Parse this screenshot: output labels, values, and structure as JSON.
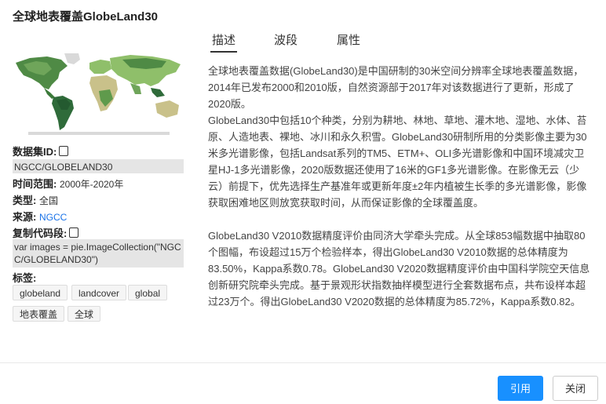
{
  "dialog": {
    "title": "全球地表覆盖GlobeLand30"
  },
  "tabs": [
    {
      "label": "描述",
      "active": true
    },
    {
      "label": "波段",
      "active": false
    },
    {
      "label": "属性",
      "active": false
    }
  ],
  "meta": {
    "dataset_id_label": "数据集ID:",
    "dataset_id_value": "NGCC/GLOBELAND30",
    "time_range_label": "时间范围:",
    "time_range_value": "2000年-2020年",
    "type_label": "类型:",
    "type_value": "全国",
    "source_label": "来源:",
    "source_value": "NGCC",
    "code_label": "复制代码段:",
    "code_value": "var images = pie.ImageCollection(\"NGCC/GLOBELAND30\")",
    "tags_label": "标签:",
    "tags": [
      "globeland",
      "landcover",
      "global",
      "地表覆盖",
      "全球"
    ]
  },
  "description": {
    "para1": "全球地表覆盖数据(GlobeLand30)是中国研制的30米空间分辨率全球地表覆盖数据，2014年已发布2000和2010版，自然资源部于2017年对该数据进行了更新，形成了2020版。",
    "para2": "GlobeLand30中包括10个种类，分别为耕地、林地、草地、灌木地、湿地、水体、苔原、人造地表、裸地、冰川和永久积雪。GlobeLand30研制所用的分类影像主要为30米多光谱影像，包括Landsat系列的TM5、ETM+、OLI多光谱影像和中国环境减灾卫星HJ-1多光谱影像，2020版数据还使用了16米的GF1多光谱影像。在影像无云（少云）前提下，优先选择生产基准年或更新年度±2年内植被生长季的多光谱影像，影像获取困难地区则放宽获取时间，从而保证影像的全球覆盖度。",
    "para3": "GlobeLand30 V2010数据精度评价由同济大学牵头完成。从全球853幅数据中抽取80个图幅，布设超过15万个检验样本，得出GlobeLand30 V2010数据的总体精度为83.50%，Kappa系数0.78。GlobeLand30 V2020数据精度评价由中国科学院空天信息创新研究院牵头完成。基于景观形状指数抽样模型进行全套数据布点，共布设样本超过23万个。得出GlobeLand30 V2020数据的总体精度为85.72%，Kappa系数0.82。"
  },
  "footer": {
    "cite_label": "引用",
    "close_label": "关闭"
  },
  "colors": {
    "primary": "#1890ff",
    "link": "#1a73e8",
    "land_green_dark": "#2f6b3a",
    "land_green_light": "#8fbf6a",
    "ice": "#d9d9d9"
  }
}
